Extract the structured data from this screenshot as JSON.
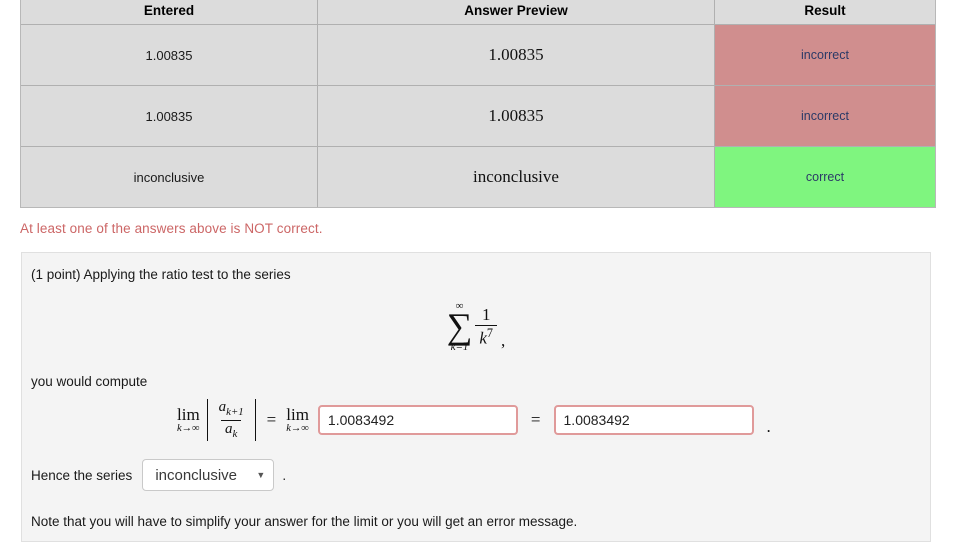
{
  "results_table": {
    "headers": [
      "Entered",
      "Answer Preview",
      "Result"
    ],
    "rows": [
      {
        "entered": "1.00835",
        "preview": "1.00835",
        "result": "incorrect",
        "status": "incorrect"
      },
      {
        "entered": "1.00835",
        "preview": "1.00835",
        "result": "incorrect",
        "status": "incorrect"
      },
      {
        "entered": "inconclusive",
        "preview": "inconclusive",
        "result": "correct",
        "status": "correct"
      }
    ],
    "colors": {
      "incorrect_bg": "#d08e8e",
      "correct_bg": "#7ff57f",
      "result_text": "#2b3a67",
      "cell_bg": "#dcdcdc"
    }
  },
  "error_banner": {
    "text": "At least one of the answers above is NOT correct.",
    "color": "#cc6666"
  },
  "problem": {
    "intro": "(1 point) Applying the ratio test to the series",
    "compute_label": "you would compute",
    "note": "Note that you will have to simplify your answer for the limit or you will get an error message.",
    "series": {
      "sigma": "∑",
      "upper_limit": "∞",
      "lower_limit": "k=1",
      "numerator": "1",
      "denominator_base": "k",
      "denominator_exponent": "7",
      "trailing_punctuation": ","
    },
    "limit_expression": {
      "lim_word": "lim",
      "lim_subscript": "k→∞",
      "ratio_numerator_base": "a",
      "ratio_numerator_sub": "k+1",
      "ratio_denominator_base": "a",
      "ratio_denominator_sub": "k",
      "equals": "=",
      "trailing_punctuation": "."
    },
    "answer_inputs": [
      {
        "value": "1.0083492",
        "placeholder": "",
        "state": "error"
      },
      {
        "value": "1.0083492",
        "placeholder": "",
        "state": "error"
      }
    ],
    "middle_equals": "=",
    "conclusion": {
      "label": "Hence the series",
      "selected_option": "inconclusive",
      "caret_icon": "chevron-down-icon",
      "trailing_punctuation": "."
    }
  }
}
